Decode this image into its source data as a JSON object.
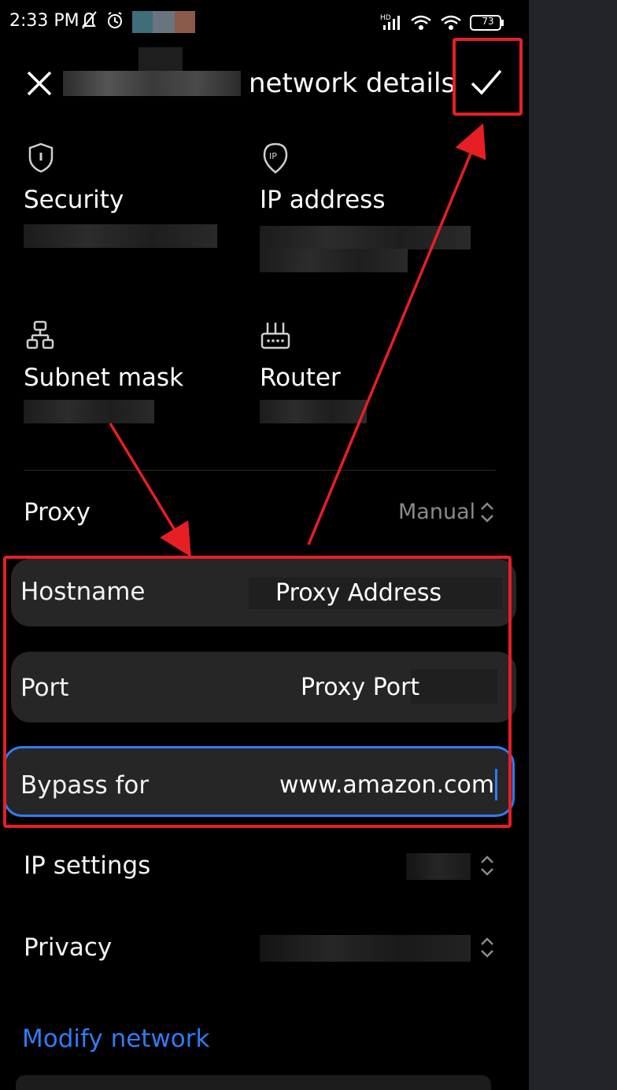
{
  "status_bar": {
    "time": "2:33 PM",
    "battery": "73",
    "hd_label": "HD"
  },
  "header": {
    "title": "network details",
    "close_icon": "close-icon",
    "confirm_icon": "checkmark-icon"
  },
  "info": {
    "security_label": "Security",
    "ip_label": "IP address",
    "subnet_label": "Subnet mask",
    "router_label": "Router"
  },
  "proxy": {
    "label": "Proxy",
    "value": "Manual"
  },
  "fields": {
    "hostname_label": "Hostname",
    "hostname_value": "Proxy Address",
    "port_label": "Port",
    "port_value": "Proxy Port",
    "bypass_label": "Bypass for",
    "bypass_value": "www.amazon.com"
  },
  "settings": {
    "ip_settings_label": "IP settings",
    "privacy_label": "Privacy"
  },
  "modify_label": "Modify network",
  "colors": {
    "accent_blue": "#2f7cf6",
    "annotation_red": "#e81e25",
    "field_bg": "#262626"
  }
}
